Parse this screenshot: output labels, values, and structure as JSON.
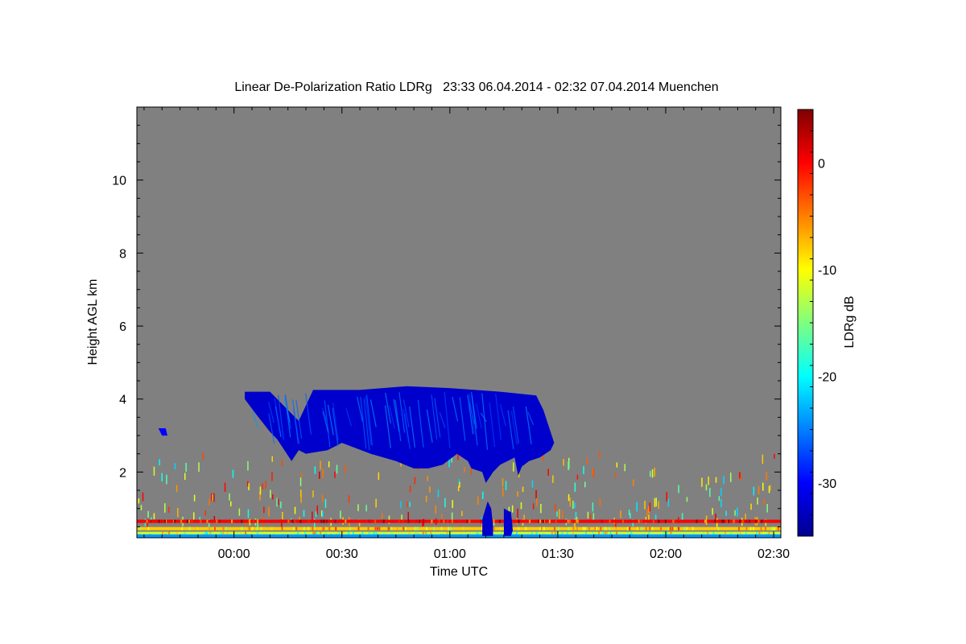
{
  "chart_data": {
    "type": "heatmap",
    "title": "Linear De-Polarization Ratio LDRg   23:33 06.04.2014 - 02:32 07.04.2014 Muenchen",
    "xlabel": "Time UTC",
    "ylabel": "Height AGL km",
    "x_unit": "minutes since 00:00 UTC",
    "xlim": [
      -27,
      152
    ],
    "ylim": [
      0.2,
      12.0
    ],
    "x_ticks": [
      {
        "value": 0,
        "label": "00:00"
      },
      {
        "value": 30,
        "label": "00:30"
      },
      {
        "value": 60,
        "label": "01:00"
      },
      {
        "value": 90,
        "label": "01:30"
      },
      {
        "value": 120,
        "label": "02:00"
      },
      {
        "value": 150,
        "label": "02:30"
      }
    ],
    "y_ticks": [
      {
        "value": 2,
        "label": "2"
      },
      {
        "value": 4,
        "label": "4"
      },
      {
        "value": 6,
        "label": "6"
      },
      {
        "value": 8,
        "label": "8"
      },
      {
        "value": 10,
        "label": "10"
      }
    ],
    "background_color": "#808080",
    "colorbar": {
      "label": "LDRg dB",
      "range": [
        -35,
        5
      ],
      "ticks": [
        {
          "value": 0,
          "label": "0"
        },
        {
          "value": -10,
          "label": "-10"
        },
        {
          "value": -20,
          "label": "-20"
        },
        {
          "value": -30,
          "label": "-30"
        }
      ],
      "colormap": "jet"
    },
    "features": [
      {
        "name": "mid-level cloud",
        "ldr_db": -32,
        "outline": [
          [
            3,
            4.2
          ],
          [
            10,
            4.2
          ],
          [
            18,
            3.4
          ],
          [
            22,
            4.25
          ],
          [
            35,
            4.25
          ],
          [
            48,
            4.35
          ],
          [
            60,
            4.3
          ],
          [
            74,
            4.2
          ],
          [
            84,
            4.1
          ],
          [
            86,
            3.7
          ],
          [
            89,
            2.8
          ],
          [
            88,
            2.6
          ],
          [
            85,
            2.4
          ],
          [
            82,
            2.3
          ],
          [
            80,
            2.15
          ],
          [
            79,
            1.9
          ],
          [
            78,
            2.4
          ],
          [
            74,
            2.2
          ],
          [
            72,
            2.0
          ],
          [
            70,
            1.7
          ],
          [
            69,
            2.0
          ],
          [
            66,
            2.1
          ],
          [
            65,
            2.3
          ],
          [
            62,
            2.5
          ],
          [
            58,
            2.2
          ],
          [
            54,
            2.1
          ],
          [
            50,
            2.1
          ],
          [
            45,
            2.3
          ],
          [
            38,
            2.5
          ],
          [
            30,
            2.8
          ],
          [
            26,
            2.6
          ],
          [
            20,
            2.5
          ],
          [
            18,
            2.6
          ],
          [
            16,
            2.3
          ],
          [
            12,
            2.9
          ],
          [
            10,
            3.1
          ],
          [
            6,
            3.6
          ],
          [
            3,
            4.0
          ]
        ]
      },
      {
        "name": "low cloud 1",
        "ldr_db": -32,
        "outline": [
          [
            69,
            0.25
          ],
          [
            69,
            0.7
          ],
          [
            70.5,
            1.2
          ],
          [
            71.5,
            1.0
          ],
          [
            72,
            0.5
          ],
          [
            72,
            0.25
          ]
        ]
      },
      {
        "name": "low cloud 2",
        "ldr_db": -32,
        "outline": [
          [
            75,
            0.25
          ],
          [
            75,
            1.0
          ],
          [
            77,
            0.9
          ],
          [
            77.5,
            0.4
          ],
          [
            77,
            0.25
          ]
        ]
      },
      {
        "name": "small patch west",
        "ldr_db": -30,
        "outline": [
          [
            -21,
            3.2
          ],
          [
            -19,
            3.2
          ],
          [
            -18.5,
            3.0
          ],
          [
            -20,
            3.0
          ]
        ]
      }
    ],
    "layers": [
      {
        "height_km": 0.65,
        "ldr_db": 0
      },
      {
        "height_km": 0.45,
        "ldr_db": -8
      },
      {
        "height_km": 0.32,
        "ldr_db": -12
      },
      {
        "height_km": 0.25,
        "ldr_db": -22
      }
    ]
  }
}
